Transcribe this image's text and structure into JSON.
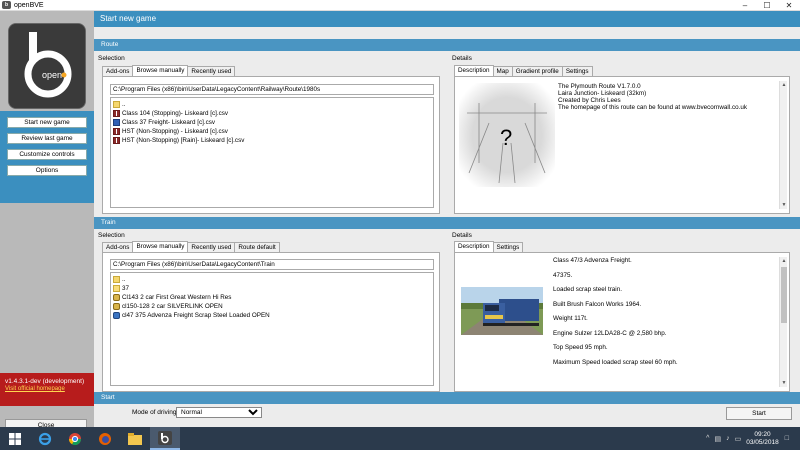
{
  "window": {
    "title": "openBVE",
    "logo_text": "open"
  },
  "sidebar": {
    "items": [
      {
        "label": "Start new game"
      },
      {
        "label": "Review last game"
      },
      {
        "label": "Customize controls"
      },
      {
        "label": "Options"
      }
    ],
    "version": "v1.4.3.1-dev (development)",
    "homepage_link": "Visit official homepage",
    "close_label": "Close"
  },
  "main": {
    "header": "Start new game"
  },
  "route": {
    "section_title": "Route",
    "selection_label": "Selection",
    "tabs": [
      {
        "label": "Add-ons"
      },
      {
        "label": "Browse manually"
      },
      {
        "label": "Recently used"
      }
    ],
    "path": "C:\\Program Files (x86)\\bin\\UserData\\LegacyContent\\Railway\\Route\\1980s",
    "files": [
      {
        "name": "..",
        "icon": "folder-up-icon"
      },
      {
        "name": "Class 104 (Stopping)- Liskeard [c].csv",
        "icon": "route-file-icon"
      },
      {
        "name": "Class 37 Freight- Liskeard [c].csv",
        "icon": "route-file-icon"
      },
      {
        "name": "HST (Non-Stopping) - Liskeard [c].csv",
        "icon": "route-file-icon"
      },
      {
        "name": "HST (Non-Stopping) [Rain]- Liskeard [c].csv",
        "icon": "route-file-icon"
      }
    ],
    "details_label": "Details",
    "detail_tabs": [
      {
        "label": "Description"
      },
      {
        "label": "Map"
      },
      {
        "label": "Gradient profile"
      },
      {
        "label": "Settings"
      }
    ],
    "description": [
      "The Plymouth Route V1.7.0.0",
      "Laira Junction- Liskeard (32km)",
      "Created by Chris Lees",
      "The homepage of this route can be found at www.bvecornwall.co.uk"
    ],
    "preview_placeholder": "?"
  },
  "train": {
    "section_title": "Train",
    "selection_label": "Selection",
    "tabs": [
      {
        "label": "Add-ons"
      },
      {
        "label": "Browse manually"
      },
      {
        "label": "Recently used"
      },
      {
        "label": "Route default"
      }
    ],
    "path": "C:\\Program Files (x86)\\bin\\UserData\\LegacyContent\\Train",
    "files": [
      {
        "name": "..",
        "icon": "folder-up-icon"
      },
      {
        "name": "37",
        "icon": "folder-icon"
      },
      {
        "name": "Cl143 2 car First Great Western Hi Res",
        "icon": "train-icon"
      },
      {
        "name": "cl150-128 2 car SILVERLINK OPEN",
        "icon": "train-icon"
      },
      {
        "name": "cl47 375 Advenza Freight Scrap Steel Loaded OPEN",
        "icon": "train-blue-icon"
      }
    ],
    "details_label": "Details",
    "detail_tabs": [
      {
        "label": "Description"
      },
      {
        "label": "Settings"
      }
    ],
    "description": [
      "Class 47/3 Advenza Freight.",
      "47375.",
      "Loaded scrap steel train.",
      "Built Brush Falcon Works 1964.",
      "Weight 117t.",
      "Engine Sulzer 12LDA28-C @ 2,580 bhp.",
      "Top Speed 95 mph.",
      "Maximum Speed loaded scrap steel 60 mph."
    ]
  },
  "start": {
    "section_title": "Start",
    "mode_label": "Mode of driving:",
    "mode_value": "Normal",
    "start_label": "Start"
  },
  "taskbar": {
    "time": "09:20",
    "date": "03/05/2018"
  }
}
